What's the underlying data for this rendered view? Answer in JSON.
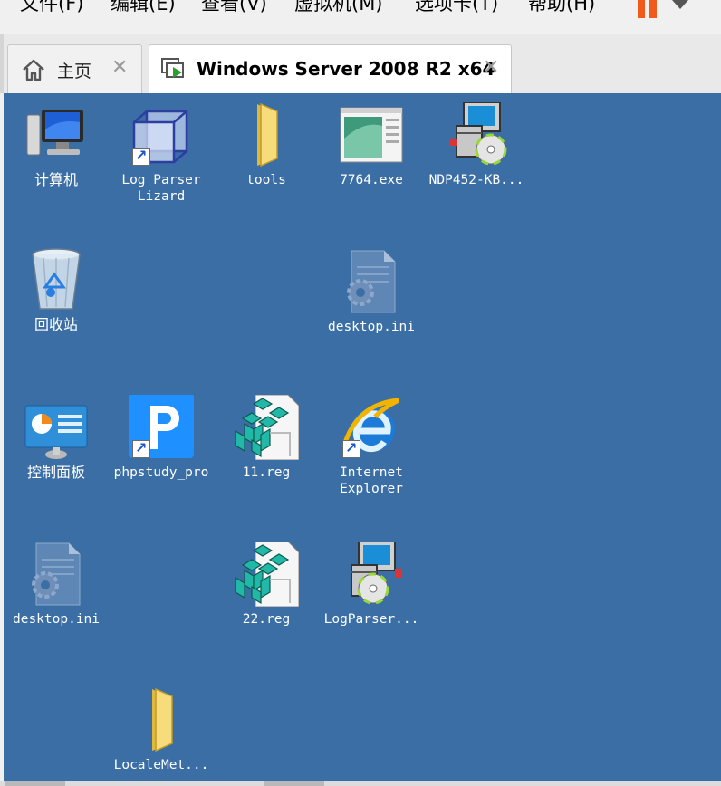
{
  "menubar": {
    "items": [
      "文件(F)",
      "编辑(E)",
      "查看(V)",
      "虚拟机(M)",
      "选项卡(T)",
      "帮助(H)"
    ]
  },
  "tabs": [
    {
      "label": "主页",
      "icon": "home-icon",
      "active": false
    },
    {
      "label": "Windows Server 2008 R2 x64",
      "icon": "vm-play-icon",
      "active": true
    }
  ],
  "desktop": {
    "background": "#3a6ea5",
    "icons": [
      {
        "label": "计算机",
        "icon": "computer-icon",
        "shortcut": false
      },
      {
        "label": "Log Parser\nLizard",
        "icon": "cube-icon",
        "shortcut": true
      },
      {
        "label": "tools",
        "icon": "folder-icon",
        "shortcut": false
      },
      {
        "label": "7764.exe",
        "icon": "app-window-icon",
        "shortcut": false
      },
      {
        "label": "NDP452-KB...",
        "icon": "installer-icon",
        "shortcut": false
      },
      {
        "label": "回收站",
        "icon": "recycle-bin-icon",
        "shortcut": false
      },
      {
        "label": "desktop.ini",
        "icon": "settings-file-icon",
        "shortcut": false
      },
      {
        "label": "控制面板",
        "icon": "control-panel-icon",
        "shortcut": false
      },
      {
        "label": "phpstudy_pro",
        "icon": "phpstudy-icon",
        "shortcut": true
      },
      {
        "label": "11.reg",
        "icon": "registry-file-icon",
        "shortcut": false
      },
      {
        "label": "Internet\nExplorer",
        "icon": "internet-explorer-icon",
        "shortcut": true
      },
      {
        "label": "desktop.ini",
        "icon": "settings-file-icon",
        "shortcut": false
      },
      {
        "label": "22.reg",
        "icon": "registry-file-icon",
        "shortcut": false
      },
      {
        "label": "LogParser...",
        "icon": "installer-icon",
        "shortcut": false
      },
      {
        "label": "LocaleMet...",
        "icon": "folder-icon",
        "shortcut": false
      }
    ]
  }
}
